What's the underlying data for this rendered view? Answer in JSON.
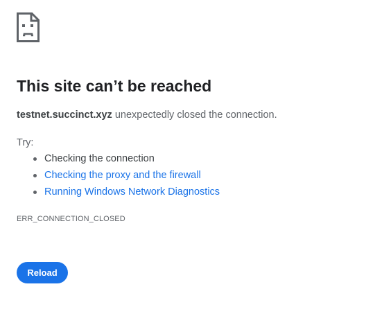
{
  "page": {
    "icon": "sad-page-icon",
    "title": "This site can’t be reached",
    "host": "testnet.succinct.xyz",
    "summary_rest": " unexpectedly closed the connection.",
    "try_label": "Try:",
    "suggestions": [
      {
        "label": "Checking the connection",
        "link": false
      },
      {
        "label": "Checking the proxy and the firewall",
        "link": true
      },
      {
        "label": "Running Windows Network Diagnostics",
        "link": true
      }
    ],
    "error_code": "ERR_CONNECTION_CLOSED",
    "reload_label": "Reload"
  },
  "colors": {
    "accent": "#1a73e8",
    "heading": "#202124",
    "secondary_text": "#5f6368"
  }
}
